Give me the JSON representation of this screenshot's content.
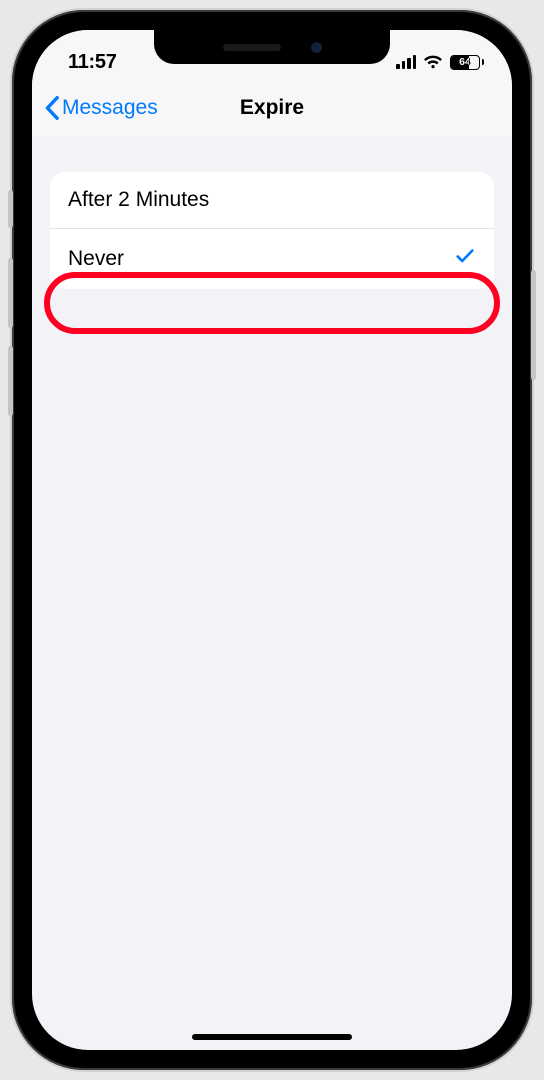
{
  "status": {
    "time": "11:57",
    "battery_pct": "64"
  },
  "nav": {
    "back_label": "Messages",
    "title": "Expire"
  },
  "options": [
    {
      "label": "After 2 Minutes",
      "selected": false
    },
    {
      "label": "Never",
      "selected": true
    }
  ],
  "highlight_index": 1
}
